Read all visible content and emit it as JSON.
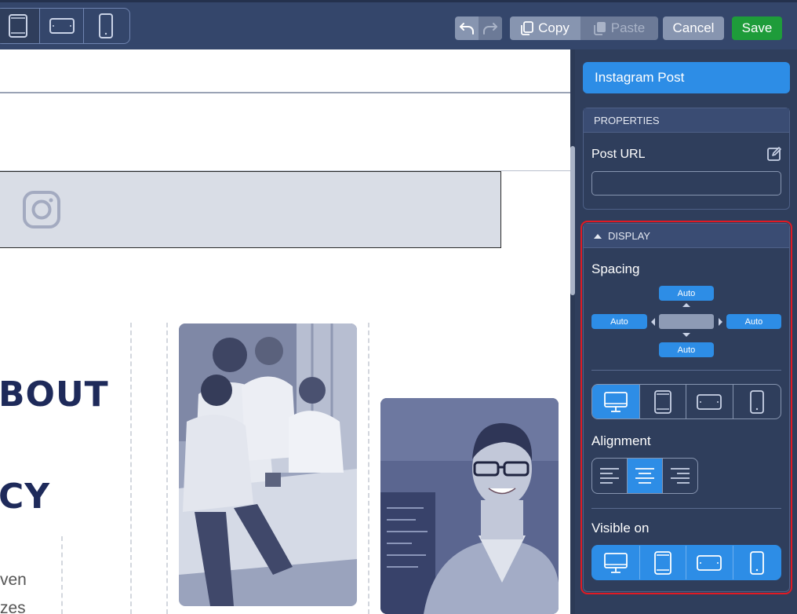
{
  "toolbar": {
    "devices": [
      "tablet-icon",
      "tablet-landscape-icon",
      "phone-icon"
    ],
    "copy_label": "Copy",
    "paste_label": "Paste",
    "cancel_label": "Cancel",
    "save_label": "Save",
    "colors": {
      "save": "#1e9c3a",
      "accent": "#2d8de6"
    }
  },
  "canvas": {
    "headline_1": "BOUT",
    "headline_2": "CY",
    "body_line_1": "ven",
    "body_line_2": "zes"
  },
  "sidebar": {
    "title": "Instagram Post",
    "properties": {
      "header": "PROPERTIES",
      "post_url_label": "Post URL",
      "post_url_value": ""
    },
    "display": {
      "header": "DISPLAY",
      "spacing_label": "Spacing",
      "spacing": {
        "top": "Auto",
        "left": "Auto",
        "right": "Auto",
        "bottom": "Auto"
      },
      "device_tabs": [
        "desktop-icon",
        "tablet-icon",
        "tablet-landscape-icon",
        "phone-icon"
      ],
      "active_device": "desktop",
      "alignment_label": "Alignment",
      "alignment_options": [
        "align-left",
        "align-center",
        "align-right"
      ],
      "active_alignment": "align-center",
      "visible_on_label": "Visible on",
      "visible_on": [
        "desktop",
        "tablet",
        "tablet-landscape",
        "phone"
      ]
    }
  }
}
